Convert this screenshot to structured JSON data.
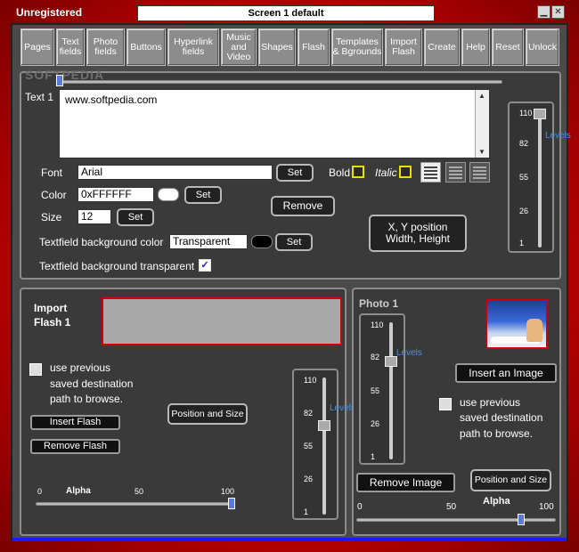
{
  "app": {
    "title": "Unregistered",
    "screen_name": "Screen 1 default",
    "watermark": "SOFTPEDIA"
  },
  "toolbar": {
    "items": [
      "Pages",
      "Text fields",
      "Photo fields",
      "Buttons",
      "Hyperlink fields",
      "Music and Video",
      "Shapes",
      "Flash",
      "Templates & Bgrounds",
      "Import Flash",
      "Create",
      "Help",
      "Reset",
      "Unlock"
    ]
  },
  "text_panel": {
    "label": "Text 1",
    "text_value": "www.softpedia.com",
    "font_label": "Font",
    "font_value": "Arial",
    "set_label": "Set",
    "bold_label": "Bold",
    "italic_label": "Italic",
    "color_label": "Color",
    "color_value": "0xFFFFFF",
    "size_label": "Size",
    "size_value": "12",
    "remove_label": "Remove",
    "xy_label_1": "X, Y position",
    "xy_label_2": "Width, Height",
    "bg_color_label": "Textfield background color",
    "bg_color_value": "Transparent",
    "bg_transparent_label": "Textfield background transparent",
    "bg_transparent_checked": true,
    "text_color": "#FFFFFF",
    "levels": {
      "label": "Levels",
      "ticks": [
        "110",
        "82",
        "55",
        "26",
        "1"
      ],
      "value": 110
    }
  },
  "flash_panel": {
    "title_1": "Import",
    "title_2": "Flash 1",
    "use_prev_1": "use previous",
    "use_prev_2": "saved destination",
    "use_prev_3": "path to browse.",
    "insert_label": "Insert Flash",
    "remove_label": "Remove Flash",
    "pos_size_label": "Position and Size",
    "alpha_label": "Alpha",
    "alpha_ticks": [
      "0",
      "50",
      "100"
    ],
    "alpha_value": 100,
    "levels": {
      "label": "Levels",
      "ticks": [
        "110",
        "82",
        "55",
        "26",
        "1"
      ],
      "value": 82
    }
  },
  "photo_panel": {
    "title": "Photo 1",
    "insert_label": "Insert an Image",
    "use_prev_1": "use previous",
    "use_prev_2": "saved destination",
    "use_prev_3": "path to browse.",
    "remove_label": "Remove Image",
    "pos_size_label": "Position and Size",
    "alpha_label": "Alpha",
    "alpha_ticks": [
      "0",
      "50",
      "100"
    ],
    "alpha_value": 80,
    "levels": {
      "label": "Levels",
      "ticks": [
        "110",
        "82",
        "55",
        "26",
        "1"
      ],
      "value": 82
    }
  }
}
